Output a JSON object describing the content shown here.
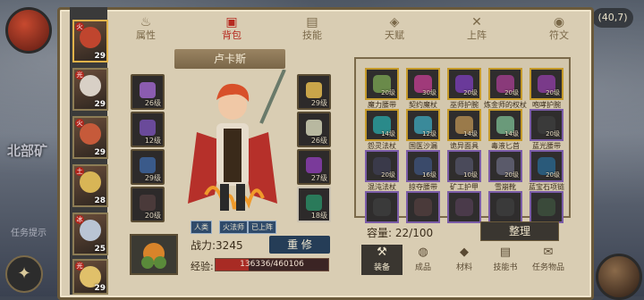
{
  "background": {
    "region_name": "北部矿",
    "quest_hint": "任务提示"
  },
  "coord_readout": "(40,7)",
  "tabs": [
    {
      "label": "属性",
      "icon": "flame-icon"
    },
    {
      "label": "背包",
      "icon": "backpack-icon"
    },
    {
      "label": "技能",
      "icon": "book-icon"
    },
    {
      "label": "天赋",
      "icon": "talent-icon"
    },
    {
      "label": "上阵",
      "icon": "crossed-swords-icon"
    },
    {
      "label": "符文",
      "icon": "rune-icon"
    }
  ],
  "active_tab": "背包",
  "roster": [
    {
      "level": "29",
      "color": "#c0452e"
    },
    {
      "level": "29",
      "color": "#d8d0c6"
    },
    {
      "level": "29",
      "color": "#c65a3a"
    },
    {
      "level": "28",
      "color": "#d8b556"
    },
    {
      "level": "25",
      "color": "#b9c4d4"
    },
    {
      "level": "29",
      "color": "#e0c06a"
    }
  ],
  "character": {
    "name": "卢卡斯",
    "tags": [
      "人类",
      "火法师",
      "已上阵"
    ],
    "power_label": "战力:",
    "power_value": "3245",
    "reforge_label": "重 修",
    "exp_label": "经验:",
    "exp_text": "136336/460106",
    "exp_ratio": 0.2963
  },
  "equip_slots_left": [
    {
      "q": "26级",
      "color": "#8b5cb0"
    },
    {
      "q": "12级",
      "color": "#6a4a9a"
    },
    {
      "q": "29级",
      "color": "#3a5a8a"
    },
    {
      "q": "20级",
      "color": "#4a3a3a"
    }
  ],
  "equip_slots_right": [
    {
      "q": "29级",
      "color": "#c9a54a"
    },
    {
      "q": "26级",
      "color": "#b8b8a0"
    },
    {
      "q": "27级",
      "color": "#7a3a9a"
    },
    {
      "q": "18级",
      "color": "#2a7a5a"
    }
  ],
  "bag": {
    "items": [
      {
        "name": "魔力腰带",
        "count": "20级",
        "border": "gold",
        "color": "#6a8a4a"
      },
      {
        "name": "契约魔杖",
        "count": "30级",
        "border": "gold",
        "color": "#a03a7a"
      },
      {
        "name": "巫师护腕",
        "count": "20级",
        "border": "gold",
        "color": "#6a3a9a"
      },
      {
        "name": "炼金师的权杖",
        "count": "20级",
        "border": "gold",
        "color": "#8a3a7a"
      },
      {
        "name": "咆哮护腕",
        "count": "20级",
        "border": "gold",
        "color": "#7a3a8a"
      },
      {
        "name": "怨灵法杖",
        "count": "14级",
        "border": "gold",
        "color": "#2a8a8a"
      },
      {
        "name": "国医沙漏",
        "count": "12级",
        "border": "gold",
        "color": "#3a8a9a"
      },
      {
        "name": "诡异面具",
        "count": "14级",
        "border": "gold",
        "color": "#9a7a4a"
      },
      {
        "name": "毒液匕首",
        "count": "14级",
        "border": "gold",
        "color": "#6a9a7a"
      },
      {
        "name": "蓝光腰带",
        "count": "20级",
        "border": "purple",
        "color": "#3a3a3a"
      },
      {
        "name": "混沌法杖",
        "count": "20级",
        "border": "purple",
        "color": "#3a3a4a"
      },
      {
        "name": "掠夺腰带",
        "count": "16级",
        "border": "purple",
        "color": "#3a4a6a"
      },
      {
        "name": "矿工护甲",
        "count": "10级",
        "border": "purple",
        "color": "#4a4a5a"
      },
      {
        "name": "雪崩靴",
        "count": "20级",
        "border": "purple",
        "color": "#5a5a6a"
      },
      {
        "name": "蓝宝石项链",
        "count": "20级",
        "border": "purple",
        "color": "#2a5a7a"
      },
      {
        "name": "",
        "count": "",
        "border": "purple",
        "color": "#3a3a3a"
      },
      {
        "name": "",
        "count": "",
        "border": "purple",
        "color": "#4a3a3a"
      },
      {
        "name": "",
        "count": "",
        "border": "purple",
        "color": "#4a3a4a"
      },
      {
        "name": "",
        "count": "",
        "border": "purple",
        "color": "#3a3a3a"
      },
      {
        "name": "",
        "count": "",
        "border": "purple",
        "color": "#3a4a3a"
      }
    ],
    "capacity_label": "容量:",
    "capacity_value": "22/100",
    "sort_label": "整理",
    "categories": [
      {
        "label": "装备",
        "icon": "hammer-icon"
      },
      {
        "label": "成品",
        "icon": "potion-icon"
      },
      {
        "label": "材料",
        "icon": "material-icon"
      },
      {
        "label": "技能书",
        "icon": "skillbook-icon"
      },
      {
        "label": "任务物品",
        "icon": "quest-item-icon"
      }
    ]
  }
}
